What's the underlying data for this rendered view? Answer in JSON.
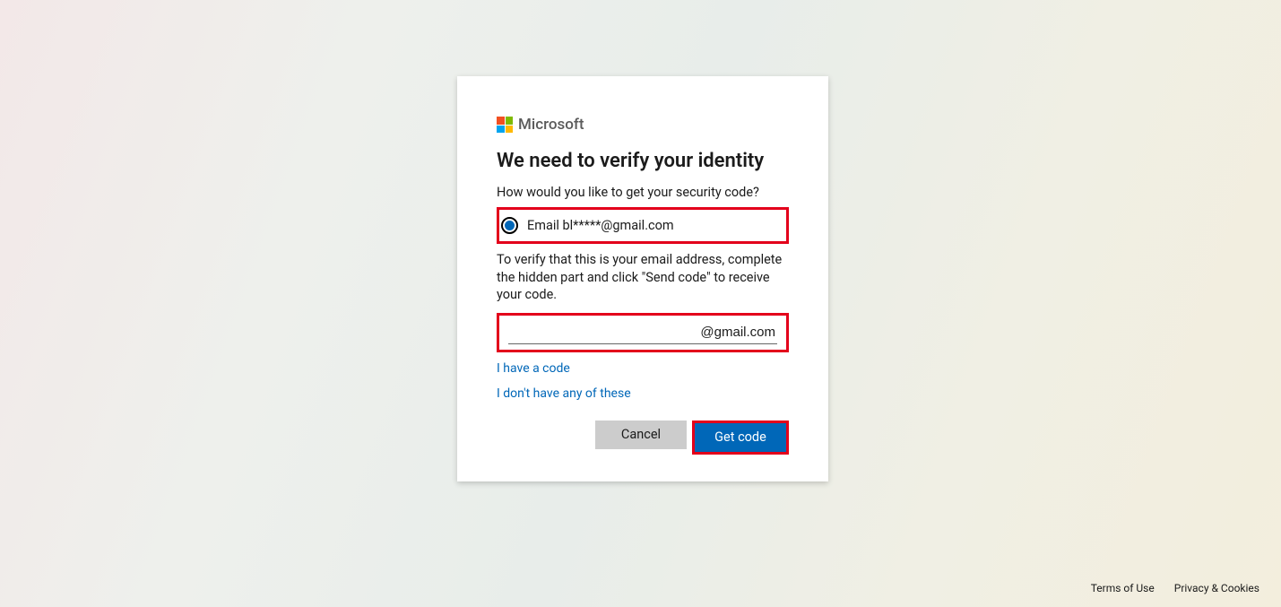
{
  "brand": {
    "name": "Microsoft"
  },
  "card": {
    "title": "We need to verify your identity",
    "subtitle": "How would you like to get your security code?",
    "radio_option_label": "Email bl*****@gmail.com",
    "instruction": "To verify that this is your email address, complete the hidden part and click \"Send code\" to receive your code.",
    "input_suffix": "@gmail.com",
    "link_have_code": "I have a code",
    "link_none": "I don't have any of these",
    "cancel_label": "Cancel",
    "submit_label": "Get code"
  },
  "footer": {
    "terms": "Terms of Use",
    "privacy": "Privacy & Cookies"
  }
}
